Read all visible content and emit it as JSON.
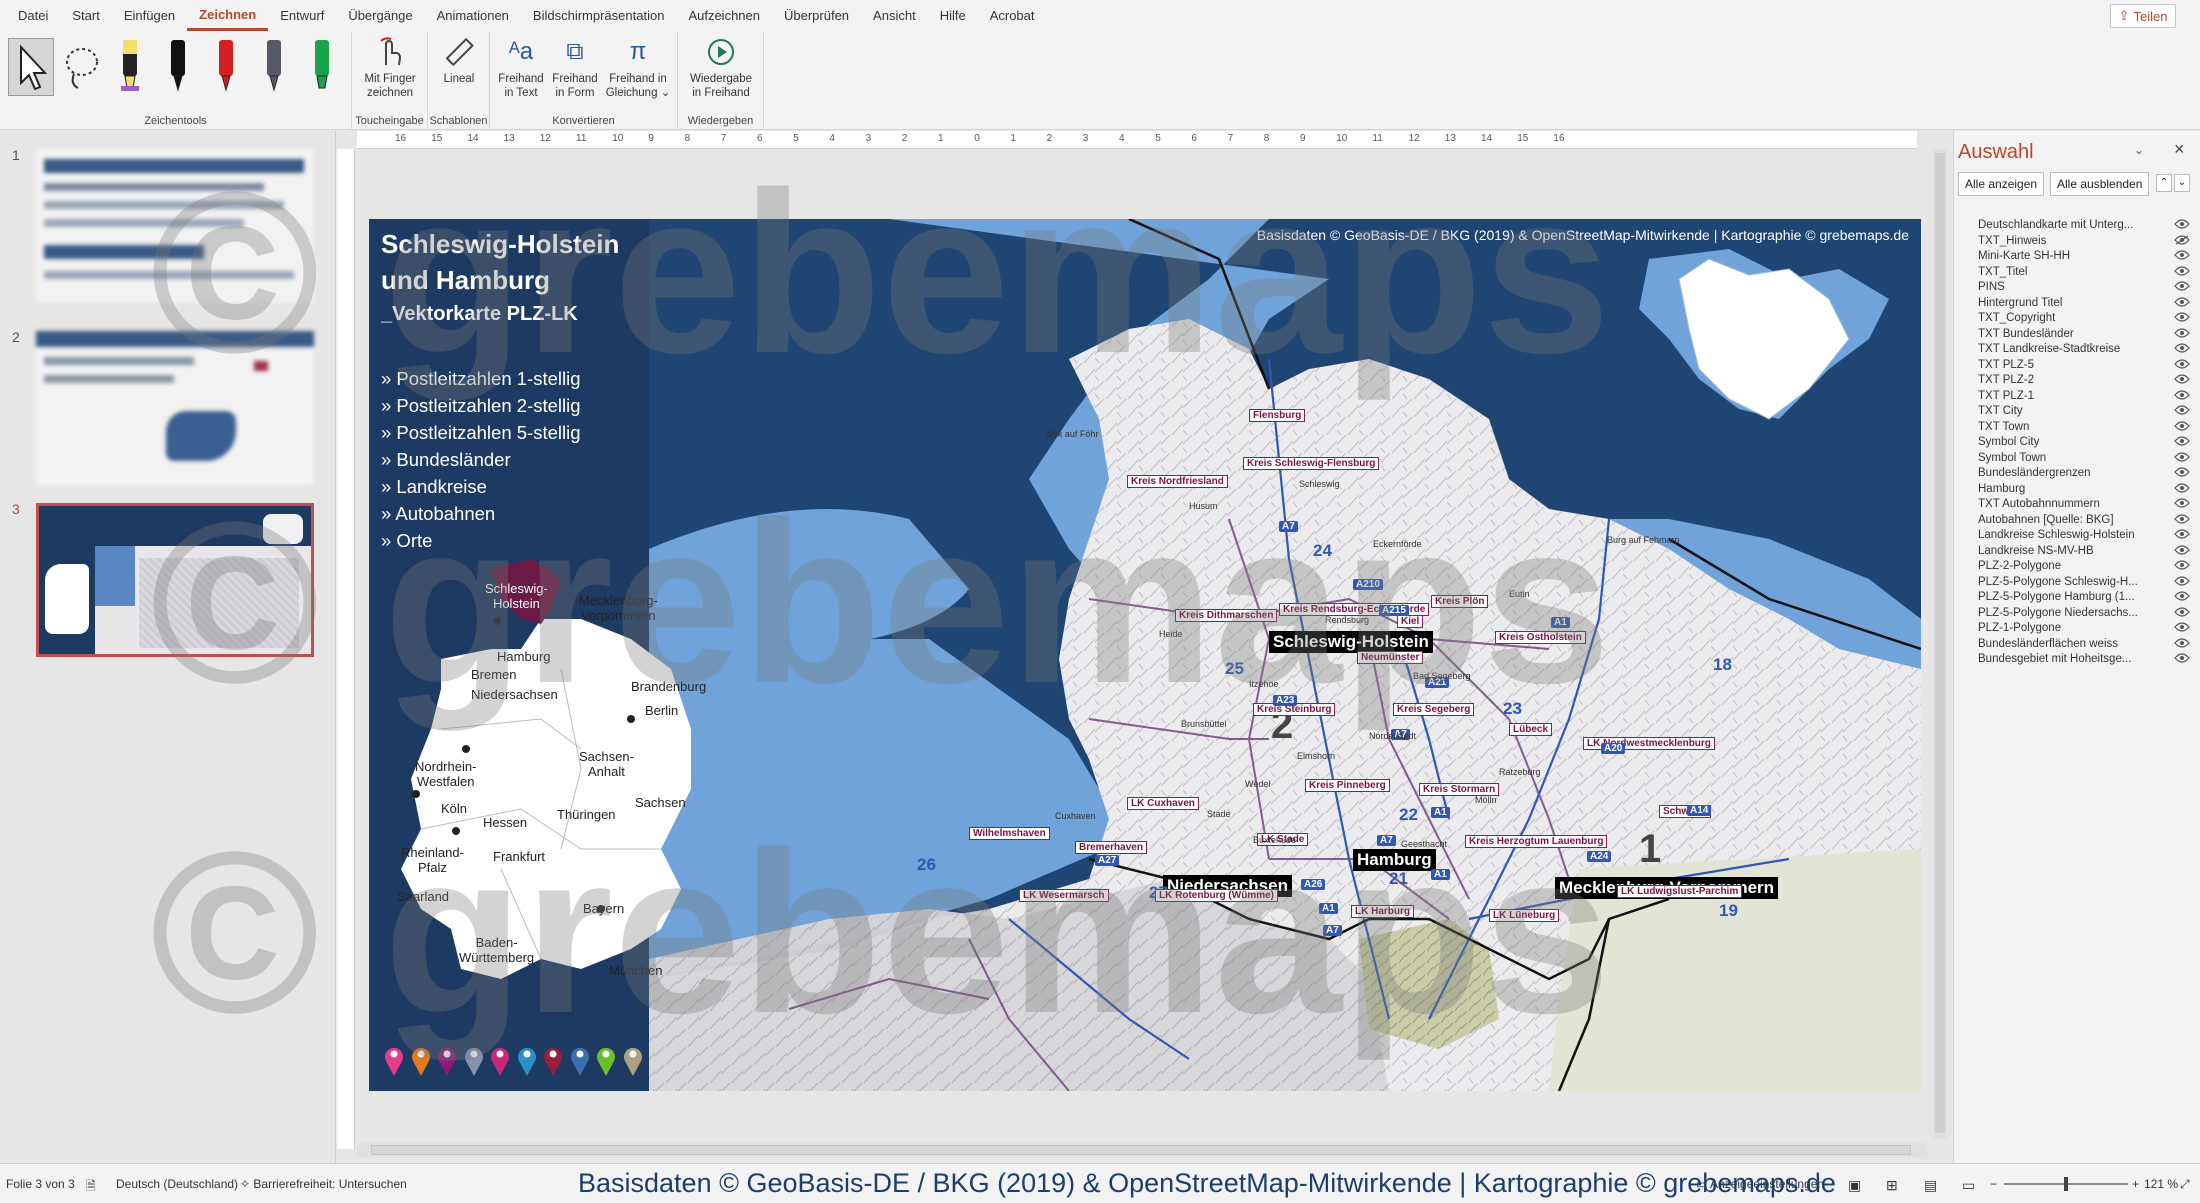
{
  "menubar": {
    "items": [
      "Datei",
      "Start",
      "Einfügen",
      "Zeichnen",
      "Entwurf",
      "Übergänge",
      "Animationen",
      "Bildschirmpräsentation",
      "Aufzeichnen",
      "Überprüfen",
      "Ansicht",
      "Hilfe",
      "Acrobat"
    ],
    "active": "Zeichnen",
    "share_label": "Teilen"
  },
  "ribbon": {
    "groups": [
      {
        "label": "Zeichentools"
      },
      {
        "label": "Toucheingabe"
      },
      {
        "label": "Schablonen"
      },
      {
        "label": "Konvertieren"
      },
      {
        "label": "Wiedergeben"
      }
    ],
    "buttons": {
      "finger_l1": "Mit Finger",
      "finger_l2": "zeichnen",
      "ruler": "Lineal",
      "text_l1": "Freihand",
      "text_l2": "in Text",
      "form_l1": "Freihand",
      "form_l2": "in Form",
      "eq_l1": "Freihand in",
      "eq_l2": "Gleichung ⌄",
      "replay_l1": "Wiedergabe",
      "replay_l2": "in Freihand"
    },
    "pen_colors": [
      "#f0e06a",
      "#111111",
      "#d42020",
      "#555a66",
      "#1aa34a"
    ]
  },
  "thumbnails": [
    {
      "number": "1"
    },
    {
      "number": "2"
    },
    {
      "number": "3"
    }
  ],
  "ruler_labels": [
    "16",
    "15",
    "14",
    "13",
    "12",
    "11",
    "10",
    "9",
    "8",
    "7",
    "6",
    "5",
    "4",
    "3",
    "2",
    "1",
    "0",
    "1",
    "2",
    "3",
    "4",
    "5",
    "6",
    "7",
    "8",
    "9",
    "10",
    "11",
    "12",
    "13",
    "14",
    "15",
    "16"
  ],
  "slide": {
    "title_l1": "Schleswig-Holstein",
    "title_l2": "und Hamburg",
    "subtitle": "_Vektorkarte PLZ-LK",
    "bullets": [
      "» Postleitzahlen 1-stellig",
      "» Postleitzahlen 2-stellig",
      "» Postleitzahlen 5-stellig",
      "» Bundesländer",
      "» Landkreise",
      "» Autobahnen",
      "» Orte"
    ],
    "copyright": "Basisdaten © GeoBasis-DE / BKG (2019) & OpenStreetMap-Mitwirkende | Kartographie © grebemaps.de",
    "mini_map_labels": {
      "sh": "Schleswig-\nHolstein",
      "hamburg": "Hamburg",
      "mv": "Mecklenburg-\nVorpommern",
      "bremen": "Bremen",
      "nds": "Niedersachsen",
      "bb": "Brandenburg",
      "berlin": "Berlin",
      "nrw": "Nordrhein-\nWestfalen",
      "sa": "Sachsen-\nAnhalt",
      "koeln": "Köln",
      "hessen": "Hessen",
      "thue": "Thüringen",
      "sachsen": "Sachsen",
      "rp": "Rheinland-\nPfalz",
      "frankfurt": "Frankfurt",
      "saar": "Saarland",
      "bayern": "Bayern",
      "bw": "Baden-\nWürttemberg",
      "muenchen": "München"
    },
    "pin_colors": [
      "#e83b8a",
      "#e07a1a",
      "#8b1b7a",
      "#8a8fb0",
      "#c8277a",
      "#2a8fc9",
      "#9b1d3d",
      "#3a6fb0",
      "#6abf2a",
      "#b0a080"
    ],
    "map_labels": {
      "state_sh": "Schleswig-Holstein",
      "state_nds": "Niedersachsen",
      "state_hh": "Hamburg",
      "state_mv": "Mecklenburg-Vorpommern",
      "plz1_2": "2",
      "plz1_1": "1",
      "plz2": [
        "24",
        "25",
        "23",
        "22",
        "21",
        "26",
        "27",
        "18",
        "19"
      ],
      "kreise": [
        "Kreis Nordfriesland",
        "Kreis Schleswig-Flensburg",
        "Flensburg",
        "Kreis Dithmarschen",
        "Kreis Rendsburg-Eckernförde",
        "Kreis Plön",
        "Kiel",
        "Kreis Ostholstein",
        "Neumünster",
        "Kreis Steinburg",
        "Kreis Segeberg",
        "Lübeck",
        "Kreis Pinneberg",
        "Kreis Stormarn",
        "Kreis Herzogtum Lauenburg",
        "LK Cuxhaven",
        "LK Stade",
        "Bremerhaven",
        "Wilhelmshaven",
        "LK Wesermarsch",
        "LK Rotenburg (Wümme)",
        "LK Harburg",
        "LK Lüneburg",
        "LK Nordwestmecklenburg",
        "Schwerin",
        "LK Ludwigslust-Parchim"
      ],
      "autobahn": [
        "A7",
        "A210",
        "A215",
        "A1",
        "A21",
        "A23",
        "A7",
        "A1",
        "A24",
        "A14",
        "A20",
        "A26",
        "A1",
        "A27",
        "A7",
        "A1",
        "A7"
      ],
      "towns": [
        "Husum",
        "Heide",
        "Schleswig",
        "Eckernförde",
        "Rendsburg",
        "Itzehoe",
        "Elmshorn",
        "Norderstedt",
        "Bad Segeberg",
        "Eutin",
        "Wyk auf Föhr",
        "Burg auf Fehmarn",
        "Cuxhaven",
        "Buxtehude",
        "Stade",
        "Geesthacht",
        "Ratzeburg",
        "Mölln",
        "Wedel",
        "Brunsbüttel"
      ]
    }
  },
  "selection_panel": {
    "title": "Auswahl",
    "show_all": "Alle anzeigen",
    "hide_all": "Alle ausblenden",
    "layers": [
      "Deutschlandkarte mit Unterg...",
      "TXT_Hinweis",
      "Mini-Karte SH-HH",
      "TXT_Titel",
      "PINS",
      "Hintergrund Titel",
      "TXT_Copyright",
      "TXT Bundesländer",
      "TXT Landkreise-Stadtkreise",
      "TXT PLZ-5",
      "TXT PLZ-2",
      "TXT PLZ-1",
      "TXT City",
      "TXT Town",
      "Symbol City",
      "Symbol Town",
      "Bundesländergrenzen",
      "Hamburg",
      "TXT Autobahnnummern",
      "Autobahnen [Quelle: BKG]",
      "Landkreise Schleswig-Holstein",
      "Landkreise NS-MV-HB",
      "PLZ-2-Polygone",
      "PLZ-5-Polygone Schleswig-H...",
      "PLZ-5-Polygone Hamburg (1...",
      "PLZ-5-Polygone Niedersachs...",
      "PLZ-1-Polygone",
      "Bundesländerflächen weiss",
      "Bundesgebiet mit Hoheitsge..."
    ]
  },
  "statusbar": {
    "slide_info": "Folie 3 von 3",
    "language": "Deutsch (Deutschland)",
    "accessibility": "Barrierefreiheit: Untersuchen",
    "display_settings": "Anzeigeeinstellungen",
    "zoom": "121 %"
  },
  "watermark": "© grebemaps",
  "bottom_copyright": "Basisdaten © GeoBasis-DE / BKG (2019) & OpenStreetMap-Mitwirkende | Kartographie © grebemaps.de"
}
